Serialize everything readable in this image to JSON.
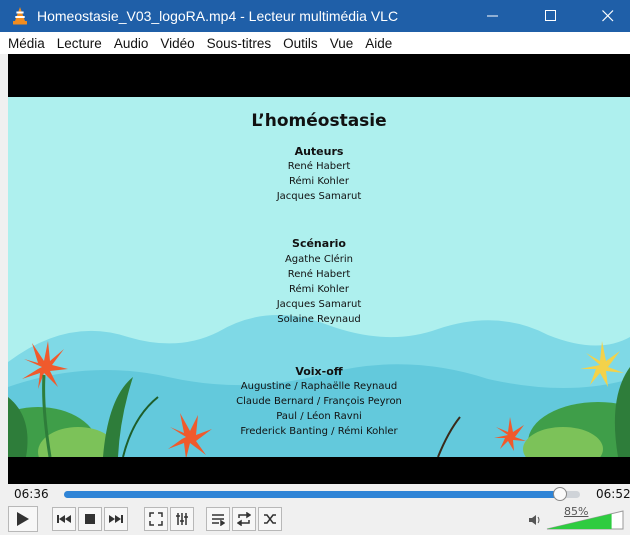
{
  "window": {
    "title": "Homeostasie_V03_logoRA.mp4 - Lecteur multimédia VLC"
  },
  "menu": [
    "Média",
    "Lecture",
    "Audio",
    "Vidéo",
    "Sous-titres",
    "Outils",
    "Vue",
    "Aide"
  ],
  "video": {
    "title": "L’homéostasie",
    "sections": [
      {
        "heading": "Auteurs",
        "names": [
          "René Habert",
          "Rémi Kohler",
          "Jacques Samarut"
        ]
      },
      {
        "heading": "Scénario",
        "names": [
          "Agathe Clérin",
          "René Habert",
          "Rémi Kohler",
          "Jacques Samarut",
          "Solaine Reynaud"
        ]
      },
      {
        "heading": "Voix-off",
        "names": [
          "Augustine / Raphaëlle Reynaud",
          "Claude Bernard / François Peyron",
          "Paul / Léon Ravni",
          "Frederick Banting / Rémi Kohler"
        ]
      }
    ]
  },
  "player": {
    "elapsed": "06:36",
    "total": "06:52",
    "progress": 0.961,
    "volume_label": "85%",
    "volume_level": 0.85
  },
  "colors": {
    "titlebar": "#1f5fa8",
    "accent": "#2f84d6",
    "volume_fill": "#2ecc40",
    "scene_bg": "#aef0ee"
  },
  "icons": {
    "app": "vlc-cone-icon",
    "minimize": "minimize-icon",
    "maximize": "maximize-icon",
    "close": "close-icon",
    "play": "play-icon",
    "previous": "previous-icon",
    "stop": "stop-icon",
    "next": "next-icon",
    "fullscreen": "fullscreen-icon",
    "extended": "extended-settings-icon",
    "playlist": "playlist-icon",
    "loop": "loop-icon",
    "shuffle": "shuffle-icon",
    "speaker": "speaker-icon"
  }
}
